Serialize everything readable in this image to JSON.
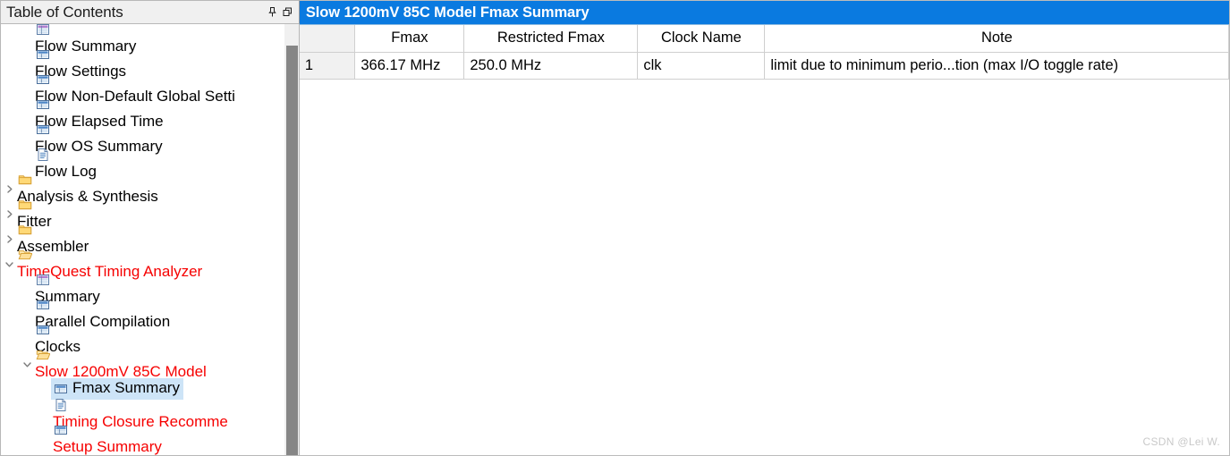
{
  "sidebar": {
    "title": "Table of Contents",
    "buttons": [
      {
        "name": "auto-hide-pin",
        "icon": "pin-icon"
      },
      {
        "name": "float-restore",
        "icon": "restore-window-icon"
      }
    ],
    "items": [
      {
        "label": "Flow Summary",
        "icon": "report-table-purple-icon",
        "indent": 1,
        "twisty": "",
        "color": "black",
        "selected": false
      },
      {
        "label": "Flow Settings",
        "icon": "report-table-blue-icon",
        "indent": 1,
        "twisty": "",
        "color": "black",
        "selected": false
      },
      {
        "label": "Flow Non-Default Global Setti",
        "icon": "report-table-blue-icon",
        "indent": 1,
        "twisty": "",
        "color": "black",
        "selected": false
      },
      {
        "label": "Flow Elapsed Time",
        "icon": "report-table-blue-icon",
        "indent": 1,
        "twisty": "",
        "color": "black",
        "selected": false
      },
      {
        "label": "Flow OS Summary",
        "icon": "report-table-blue-icon",
        "indent": 1,
        "twisty": "",
        "color": "black",
        "selected": false
      },
      {
        "label": "Flow Log",
        "icon": "document-icon",
        "indent": 1,
        "twisty": "",
        "color": "black",
        "selected": false
      },
      {
        "label": "Analysis & Synthesis",
        "icon": "folder-closed-icon",
        "indent": 0,
        "twisty": "right",
        "color": "black",
        "selected": false
      },
      {
        "label": "Fitter",
        "icon": "folder-closed-icon",
        "indent": 0,
        "twisty": "right",
        "color": "black",
        "selected": false
      },
      {
        "label": "Assembler",
        "icon": "folder-closed-icon",
        "indent": 0,
        "twisty": "right",
        "color": "black",
        "selected": false
      },
      {
        "label": "TimeQuest Timing Analyzer",
        "icon": "folder-open-icon",
        "indent": 0,
        "twisty": "down",
        "color": "red",
        "selected": false
      },
      {
        "label": "Summary",
        "icon": "report-table-purple-icon",
        "indent": 1,
        "twisty": "",
        "color": "black",
        "selected": false
      },
      {
        "label": "Parallel Compilation",
        "icon": "report-table-blue-icon",
        "indent": 1,
        "twisty": "",
        "color": "black",
        "selected": false
      },
      {
        "label": "Clocks",
        "icon": "report-table-blue-icon",
        "indent": 1,
        "twisty": "",
        "color": "black",
        "selected": false
      },
      {
        "label": "Slow 1200mV 85C Model",
        "icon": "folder-open-icon",
        "indent": 1,
        "twisty": "down",
        "color": "red",
        "selected": false
      },
      {
        "label": "Fmax Summary",
        "icon": "report-table-blue-icon",
        "indent": 2,
        "twisty": "",
        "color": "black",
        "selected": true
      },
      {
        "label": "Timing Closure Recomme",
        "icon": "document-icon",
        "indent": 2,
        "twisty": "",
        "color": "red",
        "selected": false
      },
      {
        "label": "Setup Summary",
        "icon": "report-table-blue-icon",
        "indent": 2,
        "twisty": "",
        "color": "red",
        "selected": false
      }
    ],
    "scrollbar": {
      "name": "toc-vertical-scrollbar"
    }
  },
  "content": {
    "title": "Slow 1200mV 85C Model Fmax Summary",
    "table": {
      "columns": [
        "",
        "Fmax",
        "Restricted Fmax",
        "Clock Name",
        "Note"
      ],
      "rows": [
        {
          "index": "1",
          "fmax": "366.17 MHz",
          "restricted_fmax": "250.0 MHz",
          "clock_name": "clk",
          "note": "limit due to minimum perio...tion (max I/O toggle rate)"
        }
      ]
    }
  },
  "watermark": "CSDN @Lei W.",
  "colors": {
    "title_bar": "#0a7ae0",
    "selection": "#cde4f7",
    "red_text": "#f60000",
    "panel_bg": "#f0f0f0",
    "scroll_thumb": "#868686"
  }
}
